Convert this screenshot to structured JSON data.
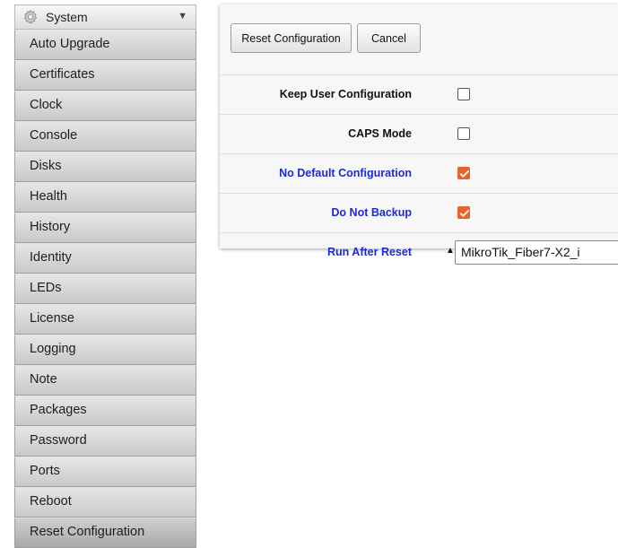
{
  "sidebar": {
    "header": {
      "icon": "gear-icon",
      "label": "System",
      "chevron": "▼"
    },
    "items": [
      {
        "label": "Auto Upgrade"
      },
      {
        "label": "Certificates"
      },
      {
        "label": "Clock"
      },
      {
        "label": "Console"
      },
      {
        "label": "Disks"
      },
      {
        "label": "Health"
      },
      {
        "label": "History"
      },
      {
        "label": "Identity"
      },
      {
        "label": "LEDs"
      },
      {
        "label": "License"
      },
      {
        "label": "Logging"
      },
      {
        "label": "Note"
      },
      {
        "label": "Packages"
      },
      {
        "label": "Password"
      },
      {
        "label": "Ports"
      },
      {
        "label": "Reboot"
      },
      {
        "label": "Reset Configuration",
        "active": true
      }
    ]
  },
  "toolbar": {
    "reset_label": "Reset Configuration",
    "cancel_label": "Cancel"
  },
  "form": {
    "keep_user_config": {
      "label": "Keep User Configuration",
      "checked": false
    },
    "caps_mode": {
      "label": "CAPS Mode",
      "checked": false
    },
    "no_default_config": {
      "label": "No Default Configuration",
      "checked": true
    },
    "do_not_backup": {
      "label": "Do Not Backup",
      "checked": true
    },
    "run_after_reset": {
      "label": "Run After Reset",
      "arrow": "▲",
      "value": "MikroTik_Fiber7-X2_i"
    }
  },
  "colors": {
    "accent": "#e8632e",
    "link_label": "#1d2bd0"
  }
}
